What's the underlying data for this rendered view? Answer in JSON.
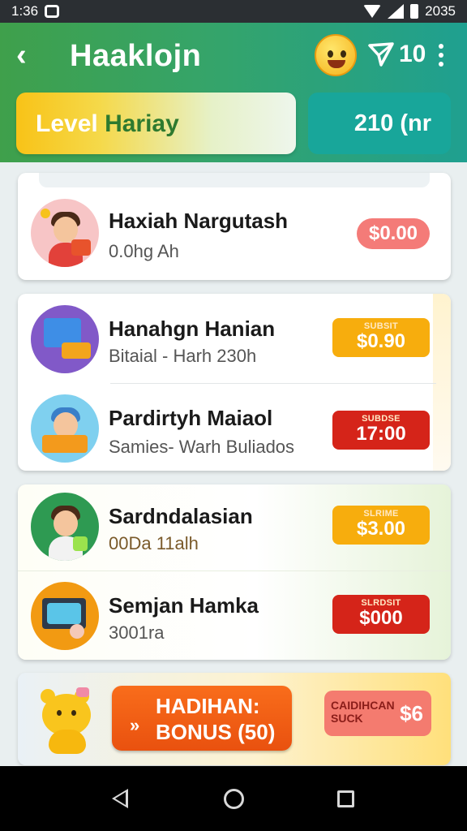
{
  "status_bar": {
    "time": "1:36",
    "battery": "2035"
  },
  "header": {
    "title": "Haaklojn",
    "counter": "10",
    "level_label_a": "Level ",
    "level_label_b": "Hariay",
    "points": "210 (nr"
  },
  "sections": [
    {
      "items": [
        {
          "name": "Haxiah Nargutash",
          "subtitle": "0.0hg Ah",
          "price": "$0.00",
          "price_style": "pill"
        }
      ]
    },
    {
      "items": [
        {
          "name": "Hanahgn Hanian",
          "subtitle": "Bitaial - Harh 230h",
          "tag": "SUBSIT",
          "price": "$0.90",
          "price_style": "orange"
        },
        {
          "name": "Pardirtyh Maiaol",
          "subtitle": "Samies- Warh Buliados",
          "tag": "SUBDSE",
          "price": "17:00",
          "price_style": "red"
        }
      ]
    },
    {
      "items": [
        {
          "name": "Sardndalasian",
          "subtitle": "00Da 11alh",
          "tag": "SLRIME",
          "price": "$3.00",
          "price_style": "orange"
        },
        {
          "name": "Semjan Hamka",
          "subtitle": "3001ra",
          "tag": "SLRDSIT",
          "price": "$000",
          "price_style": "red"
        }
      ]
    }
  ],
  "bonus": {
    "line1": "HADIHAN:",
    "line2": "BONUS (50)",
    "price_tag": "CAIDIHCAN SUCK",
    "price": "$6"
  },
  "colors": {
    "header_gradient_start": "#3fa04b",
    "header_gradient_end": "#1fa090",
    "orange_price": "#f7ad0d",
    "red_price": "#d52419",
    "pill_price": "#f47b78",
    "bonus_button": "#e9510f"
  },
  "icons": {
    "back": "arrow-left-icon",
    "mascot": "smiley-mascot-icon",
    "send": "paper-plane-icon",
    "menu": "kebab-menu-icon",
    "bonus_mascot": "bear-mascot-icon"
  }
}
